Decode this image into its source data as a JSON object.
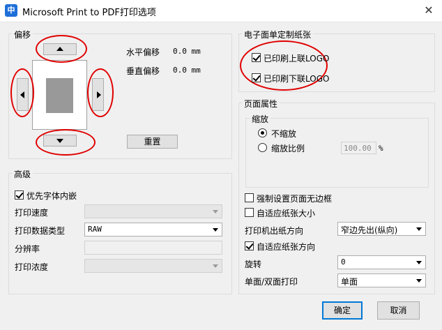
{
  "window": {
    "title": "Microsoft Print to PDF打印选项",
    "app_icon_text": "中",
    "close_glyph": "✕"
  },
  "offset": {
    "legend": "偏移",
    "horizontal_label": "水平偏移",
    "horizontal_value": "0.0 mm",
    "vertical_label": "垂直偏移",
    "vertical_value": "0.0 mm",
    "reset_label": "重置"
  },
  "eticket": {
    "legend": "电子面单定制纸张",
    "print_top_logo": "已印刷上联LOGO",
    "print_top_logo_checked": true,
    "print_bottom_logo": "已印刷下联LOGO",
    "print_bottom_logo_checked": true
  },
  "page_props": {
    "legend": "页面属性",
    "zoom_legend": "缩放",
    "no_zoom": "不缩放",
    "zoom_ratio": "缩放比例",
    "zoom_value": "100.00",
    "zoom_unit": "%",
    "force_borderless": "强制设置页面无边框",
    "auto_fit_size": "自适应纸张大小",
    "feed_direction_label": "打印机出纸方向",
    "feed_direction_value": "窄边先出(纵向)",
    "auto_fit_direction": "自适应纸张方向",
    "rotate_label": "旋转",
    "rotate_value": "0",
    "duplex_label": "单面/双面打印",
    "duplex_value": "单面"
  },
  "advanced": {
    "legend": "高级",
    "prefer_font_embed": "优先字体内嵌",
    "print_speed_label": "打印速度",
    "print_speed_value": "",
    "print_data_type_label": "打印数据类型",
    "print_data_type_value": "RAW",
    "resolution_label": "分辨率",
    "resolution_value": "",
    "print_density_label": "打印浓度",
    "print_density_value": ""
  },
  "buttons": {
    "ok": "确定",
    "cancel": "取消"
  },
  "colors": {
    "annotation_circle": "#e00000",
    "primary_border": "#0078d7"
  }
}
